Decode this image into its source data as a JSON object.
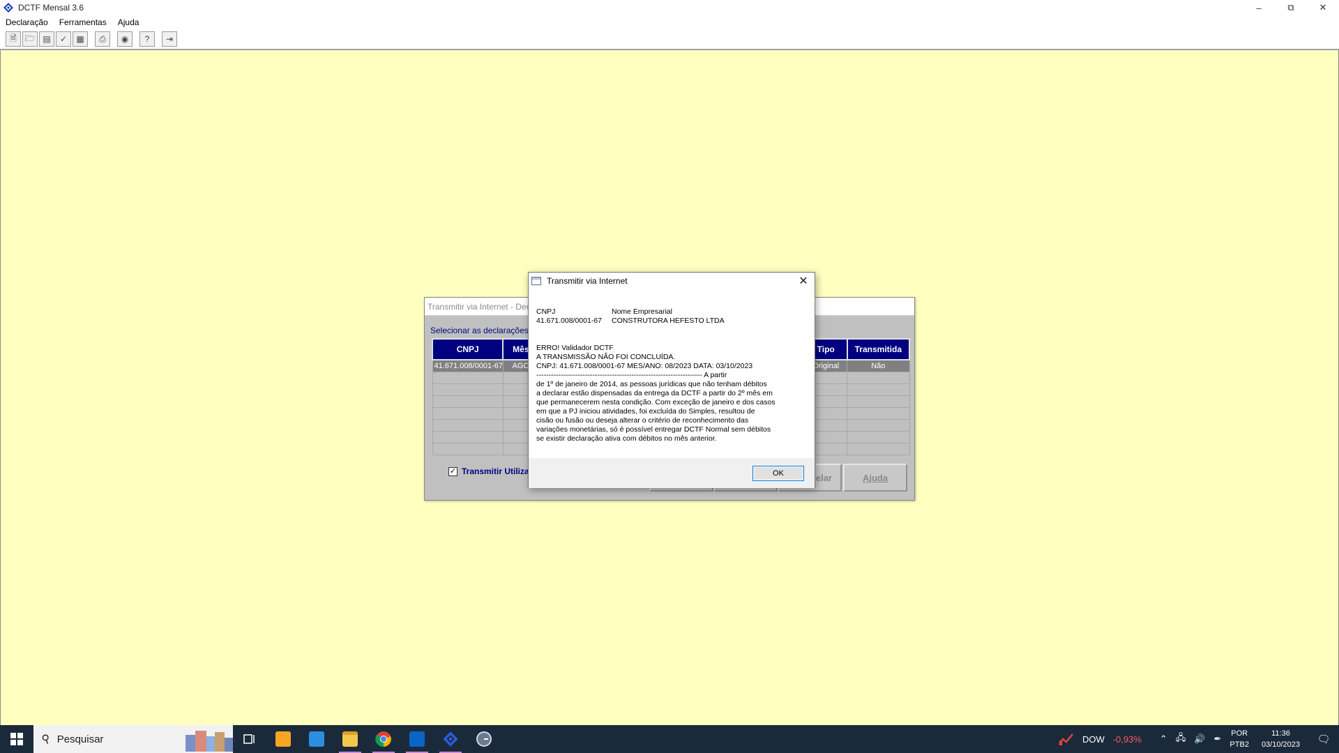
{
  "app": {
    "title": "DCTF Mensal 3.6"
  },
  "menu": [
    "Declaração",
    "Ferramentas",
    "Ajuda"
  ],
  "toolbar_icons": [
    "new-doc-icon",
    "open-folder-icon",
    "save-icon",
    "check-icon",
    "calculator-icon",
    "print-icon",
    "globe-icon",
    "help-icon",
    "exit-icon"
  ],
  "bg_dialog": {
    "title": "Transmitir via Internet - Dec",
    "instruction": "Selecionar as declarações a s",
    "columns": [
      "CNPJ",
      "Mês",
      "Tipo",
      "Transmitida"
    ],
    "row": {
      "cnpj": "41.671.008/0001-67",
      "mes": "AGO",
      "tipo": "Original",
      "transmitida": "Não"
    },
    "checkbox_label": "Transmitir Utiliza",
    "cancel_label": "elar",
    "help_label": "Ajuda"
  },
  "modal": {
    "title": "Transmitir via Internet",
    "cnpj_label": "CNPJ",
    "name_label": "Nome Empresarial",
    "cnpj_value": "41.671.008/0001-67",
    "name_value": "CONSTRUTORA HEFESTO LTDA",
    "err1": "ERRO! Validador DCTF",
    "err2": "A TRANSMISSÃO NÃO FOI CONCLUÍDA.",
    "err3": "CNPJ: 41.671.008/0001-67 MES/ANO: 08/2023 DATA: 03/10/2023",
    "body": [
      "-------------------------------------------------------------------- A partir",
      "de 1º de janeiro de 2014, as pessoas jurídicas que não tenham débitos",
      "a declarar estão dispensadas da entrega da DCTF a partir do 2º mês em",
      "que permanecerem nesta condição. Com exceção de janeiro e dos casos",
      "em que a PJ iniciou atividades, foi excluída do Simples, resultou de",
      "cisão ou fusão ou deseja alterar o critério de reconhecimento das",
      "variações monetárias, só é possível entregar DCTF Normal sem débitos",
      "se existir declaração ativa com débitos no mês anterior."
    ],
    "ok_label": "OK"
  },
  "taskbar": {
    "search_placeholder": "Pesquisar",
    "stock_name": "DOW",
    "stock_change": "-0,93%",
    "lang1": "POR",
    "lang2": "PTB2",
    "time": "11:36",
    "date": "03/10/2023"
  },
  "colors": {
    "workspace": "#ffffc0",
    "header": "#000080",
    "stock_down": "#ff5a5a"
  }
}
